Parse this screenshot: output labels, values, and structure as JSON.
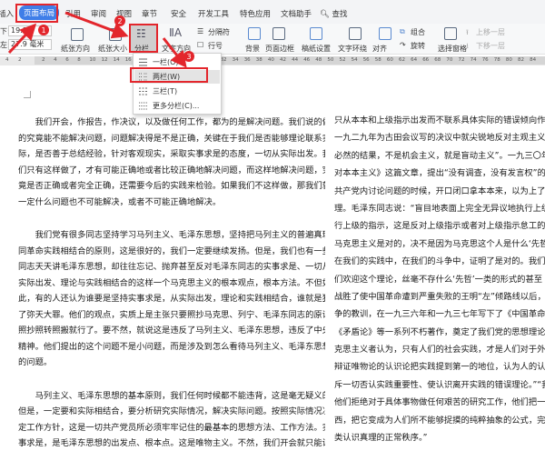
{
  "tabs": [
    {
      "label": "插入",
      "active": false
    },
    {
      "label": "页面布局",
      "active": true
    },
    {
      "label": "引用",
      "active": false
    },
    {
      "label": "审阅",
      "active": false
    },
    {
      "label": "视图",
      "active": false
    },
    {
      "label": "章节",
      "active": false
    },
    {
      "label": "安全",
      "active": false
    },
    {
      "label": "开发工具",
      "active": false
    },
    {
      "label": "特色应用",
      "active": false
    },
    {
      "label": "文档助手",
      "active": false
    }
  ],
  "search_label": "查找",
  "ribbon": {
    "margin_bottom_label": "下:",
    "margin_bottom_value": "19.1",
    "margin_left_label": "左:",
    "margin_left_value": "27.9 毫米",
    "orientation": "纸张方向",
    "size": "纸张大小",
    "columns": "分栏",
    "text_direction": "文字方向",
    "breaks": "分隔符",
    "line_numbers": "行号",
    "background": "背景",
    "page_border": "页面边框",
    "manuscript": "稿纸设置",
    "wrap": "文字环绕",
    "align": "对齐",
    "group": "组合",
    "rotate": "旋转",
    "selection_pane": "选择窗格",
    "bring_forward": "上移一层",
    "send_backward": "下移一层"
  },
  "ruler": {
    "labels": [
      "4",
      "2",
      "2",
      "4",
      "6",
      "8",
      "10",
      "12",
      "14",
      "16",
      "18",
      "20",
      "22",
      "24",
      "26",
      "28",
      "30",
      "32",
      "34",
      "36",
      "38",
      "40",
      "42",
      "44",
      "46",
      "48",
      "50",
      "52",
      "54",
      "56",
      "58",
      "60",
      "62",
      "64",
      "66",
      "68",
      "70",
      "72",
      "74",
      "76",
      "78",
      "80",
      "82",
      "84"
    ]
  },
  "columns_menu": {
    "items": [
      {
        "label": "一栏(O)",
        "icon": "one-column-icon"
      },
      {
        "label": "两栏(W)",
        "icon": "two-columns-icon",
        "highlighted": true
      },
      {
        "label": "三栏(T)",
        "icon": "three-columns-icon"
      },
      {
        "label": "更多分栏(C)...",
        "icon": "more-columns-icon"
      }
    ]
  },
  "annotations": {
    "step1": "1",
    "step2": "2",
    "step3": "3",
    "color": "#e3262c"
  },
  "document": {
    "left_column": [
      [
        "　　我们开会，作报告，作决议，以及做任何工作，都为的是解决问题。我们说的做",
        "的究竟能不能解决问题，问题解决得是不是正确，关键在于我们是否能够理论联系实",
        "际，是否善于总结经验，针对客观现实，采取实事求是的态度，一切从实际出发。我",
        "们只有这样做了，才有可能正确地或者比较正确地解决问题，而这样地解决问题，究",
        "竟是否正确或者完全正确，还需要今后的实践来检验。如果我们不这样做，那我们就",
        "一定什么问题也不可能解决，或者不可能正确地解决。"
      ],
      [
        "　　我们党有很多同志坚持学习马列主义、毛泽东思想，坚持把马列主义的普遍真理",
        "同革命实践相结合的原则，这是很好的，我们一定要继续发扬。但是，我们也有一些",
        "同志天天讲毛泽东思想，却往往忘记、抛弃甚至反对毛泽东同志的实事求是、一切从",
        "实际出发、理论与实践相结合的这样一个马克思主义的根本观点，根本方法。不但如",
        "此，有的人还认为谁要是坚持实事求是，从实际出发，理论和实践相结合，谁就是犯",
        "了弥天大罪。他们的观点，实质上是主张只要照抄马克思、列宁、毛泽东同志的原话，",
        "照抄照转照搬就行了。要不然，就说这是违反了马列主义、毛泽东思想，违反了中央",
        "精神。他们提出的这个问题不是小问题，而是涉及到怎么看待马列主义、毛泽东思想",
        "的问题。"
      ],
      [
        "　　马列主义、毛泽东思想的基本原则，我们任何时候都不能违背，这是毫无疑义的。",
        "但是，一定要和实际相结合，要分析研究实际情况，解决实际问题。按照实际情况决",
        "定工作方针，这是一切共产党员所必须牢牢记住的最基本的思想方法、工作方法。实",
        "事求是，是毛泽东思想的出发点、根本点。这是唯物主义。不然，我们开会就只能讲"
      ]
    ],
    "right_column": [
      "只从本本和上级指示出发而不联系具体实际的错误倾向作坚决的斗争。",
      "一九二九年为古田会议写的决议中就尖锐地反对主观主义的",
      "必然的结果，不是机会主义，就是盲动主义”。一九三〇年，毛",
      "对本本主义》这篇文章，提出“没有调查，没有发言权”的科",
      "共产党内讨论问题的时候，开口闭口拿本本来，以为上了书的",
      "理。毛泽东同志说：“盲目地表面上完全无异议地执行上级的",
      "行上级的指示，这是反对上级指示或者对上级指示怠工的最好",
      "马克思主义是对的，决不是因为马克思这个人是什么‘先哲’",
      "在我们的实践中，在我们的斗争中，证明了是对的。我们的斗",
      "们欢迎这个理论，丝毫不存什么‘先哲’一类的形式的甚至",
      "战胜了使中国革命遭到严重失败的王明“左”倾路线以后，毛",
      "争的教训，在一九三六年和一九三七年写下了《中国革命战争",
      "《矛盾论》等一系列不朽著作，奠定了我们党的思想理论基础",
      "克思主义者认为，只有人们的社会实践，才是人们对于外界认",
      "辩证唯物论的认识论把实践提到第一的地位，认为人的认识一",
      "斥一切否认实践重要性、使认识离开实践的错误理论。”“我",
      "他们拒绝对于具体事物做任何艰苦的研究工作，他们把一般真",
      "西，把它变成为人们所不能够捉摸的纯粹抽象的公式，完全否",
      "类认识真理的正常秩序。”"
    ]
  }
}
